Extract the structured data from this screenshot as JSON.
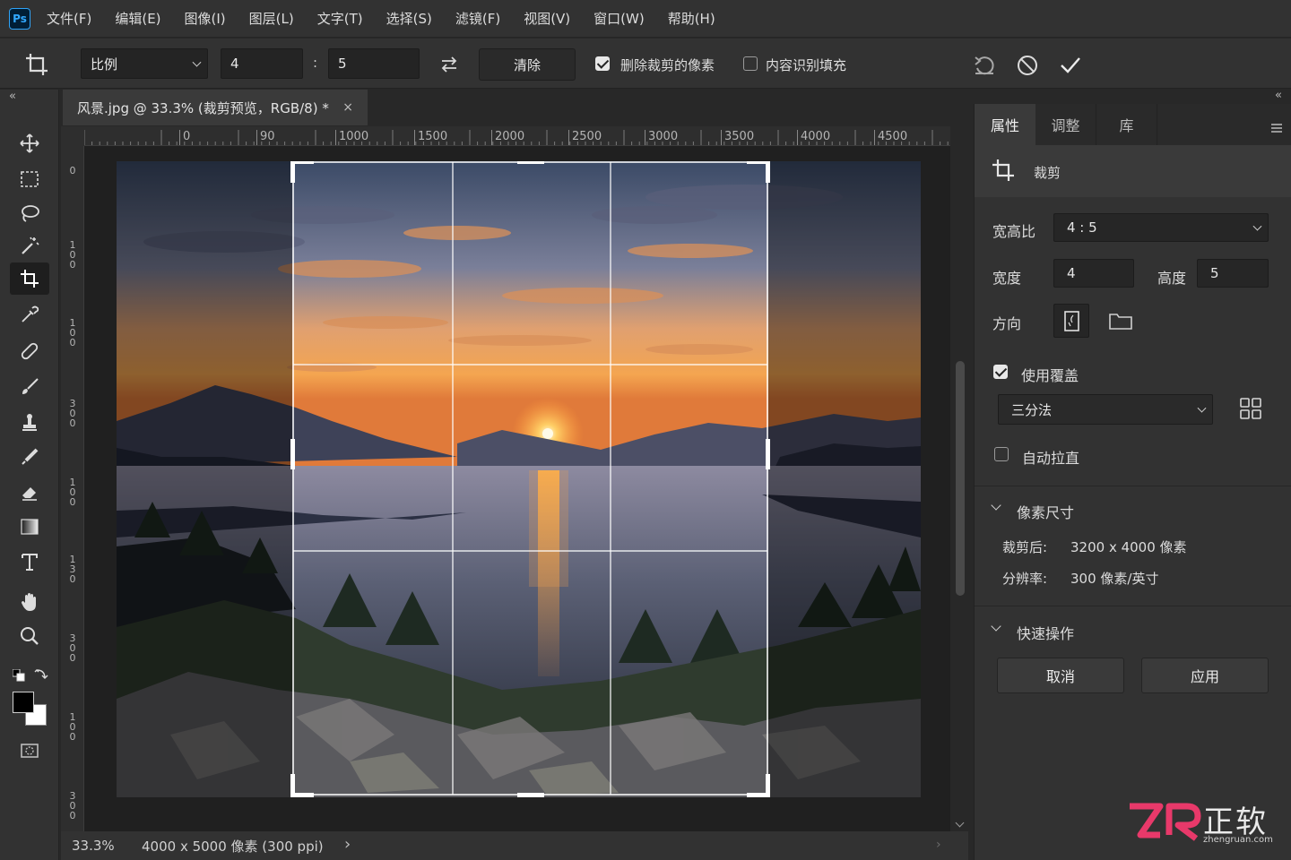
{
  "app": {
    "logo": "Ps"
  },
  "menu": [
    "文件(F)",
    "编辑(E)",
    "图像(I)",
    "图层(L)",
    "文字(T)",
    "选择(S)",
    "滤镜(F)",
    "视图(V)",
    "窗口(W)",
    "帮助(H)"
  ],
  "options": {
    "ratio_mode": "比例",
    "width": "4",
    "separator": ":",
    "height": "5",
    "clear_label": "清除",
    "delete_pixels_label": "删除裁剪的像素",
    "delete_pixels_checked": true,
    "content_aware_label": "内容识别填充",
    "content_aware_checked": false
  },
  "document": {
    "tab_title": "风景.jpg @ 33.3% (裁剪预览，RGB/8) *",
    "close_glyph": "×",
    "zoom": "33.3%",
    "doc_info": "4000 x 5000 像素 (300 ppi)",
    "status_arrow": "›"
  },
  "rulers": {
    "horizontal": [
      "0",
      "90",
      "1000",
      "1500",
      "2000",
      "2500",
      "3000",
      "3500",
      "4000",
      "4500"
    ],
    "vertical": [
      "0",
      "100",
      "100",
      "300",
      "100",
      "130",
      "300",
      "100",
      "300"
    ]
  },
  "panel": {
    "collapse_left": "«",
    "collapse_right": "«",
    "tabs": [
      "属性",
      "调整",
      "库"
    ],
    "active_tab": 0,
    "section_title": "裁剪",
    "aspect_label": "宽高比",
    "aspect_value": "4 : 5",
    "width_label": "宽度",
    "width_value": "4",
    "height_label": "高度",
    "height_value": "5",
    "orientation_label": "方向",
    "overlay_label": "使用覆盖",
    "overlay_checked": true,
    "overlay_value": "三分法",
    "auto_straighten_label": "自动拉直",
    "auto_straighten_checked": false,
    "pixel_size_title": "像素尺寸",
    "crop_after_label": "裁剪后:",
    "crop_after_value": "3200 x 4000 像素",
    "resolution_label": "分辨率:",
    "resolution_value": "300 像素/英寸",
    "quick_actions_title": "快速操作",
    "cancel_label": "取消",
    "apply_label": "应用"
  },
  "watermark": {
    "brand": "正软",
    "site": "zhengruan.com"
  }
}
